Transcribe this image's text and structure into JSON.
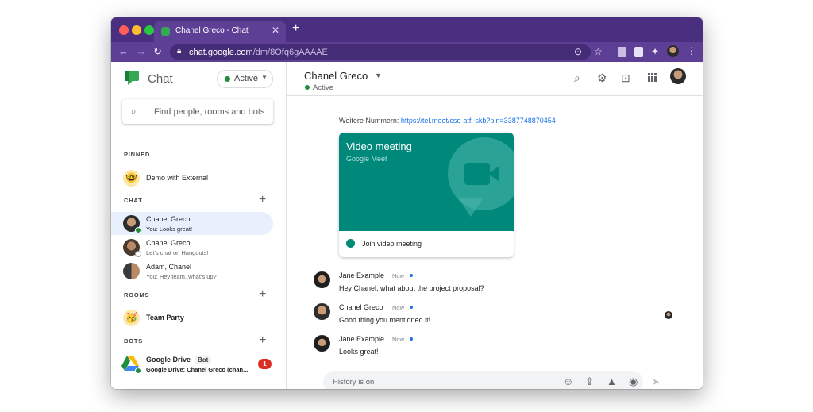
{
  "browser": {
    "tab_title": "Chanel Greco - Chat",
    "new_tab_glyph": "+",
    "close_glyph": "✕",
    "url_host": "chat.google.com",
    "url_path": "/dm/8Ofq6gAAAAE",
    "icons": [
      "back-icon",
      "forward-icon",
      "reload-icon",
      "lock-icon",
      "target-icon",
      "star-icon",
      "extension-icon",
      "puzzle-icon",
      "profile-avatar",
      "menu-icon"
    ]
  },
  "sidebar": {
    "app_name": "Chat",
    "status_label": "Active",
    "search_placeholder": "Find people, rooms and bots",
    "pinned_header": "PINNED",
    "pinned": [
      {
        "name": "Demo with External",
        "emoji": "🤓"
      }
    ],
    "chat_header": "CHAT",
    "chats": [
      {
        "name": "Chanel Greco",
        "preview": "You: Looks great!",
        "selected": true
      },
      {
        "name": "Chanel Greco",
        "preview": "Let's chat on Hangouts!",
        "selected": false
      },
      {
        "name": "Adam, Chanel",
        "preview": "You: Hey team, what's up?",
        "selected": false
      }
    ],
    "rooms_header": "ROOMS",
    "rooms": [
      {
        "name": "Team Party",
        "emoji": "🥳"
      }
    ],
    "bots_header": "BOTS",
    "bots": [
      {
        "name": "Google Drive",
        "badge": "Bot",
        "preview": "Google Drive: Chanel Greco (chan...",
        "unread": "1"
      }
    ]
  },
  "header": {
    "name": "Chanel Greco",
    "status": "Active",
    "icons": [
      "search-icon",
      "gear-icon",
      "feedback-icon",
      "apps-grid-icon",
      "account-avatar"
    ]
  },
  "conversation": {
    "info_label": "Weitere Nummern:",
    "info_link": "https://tel.meet/cso-atfi-skb?pin=3387748870454",
    "meet_card": {
      "title": "Video meeting",
      "subtitle": "Google Meet",
      "join_label": "Join video meeting"
    },
    "messages": [
      {
        "author": "Jane Example",
        "time": "Now",
        "text": "Hey Chanel, what about the project proposal?"
      },
      {
        "author": "Chanel Greco",
        "time": "Now",
        "text": "Good thing you mentioned it!"
      },
      {
        "author": "Jane Example",
        "time": "Now",
        "text": "Looks great!"
      }
    ]
  },
  "compose": {
    "placeholder": "History is on",
    "icons": [
      "emoji-icon",
      "upload-icon",
      "drive-icon",
      "meet-icon",
      "send-icon"
    ]
  },
  "colors": {
    "browser_frame": "#4a2f80",
    "browser_toolbar": "#5d3f96",
    "meet_card": "#00897b",
    "active_green": "#1e8e3e",
    "link_blue": "#1a73e8",
    "unread_red": "#d93025",
    "selected_row": "#e8f0fe"
  }
}
